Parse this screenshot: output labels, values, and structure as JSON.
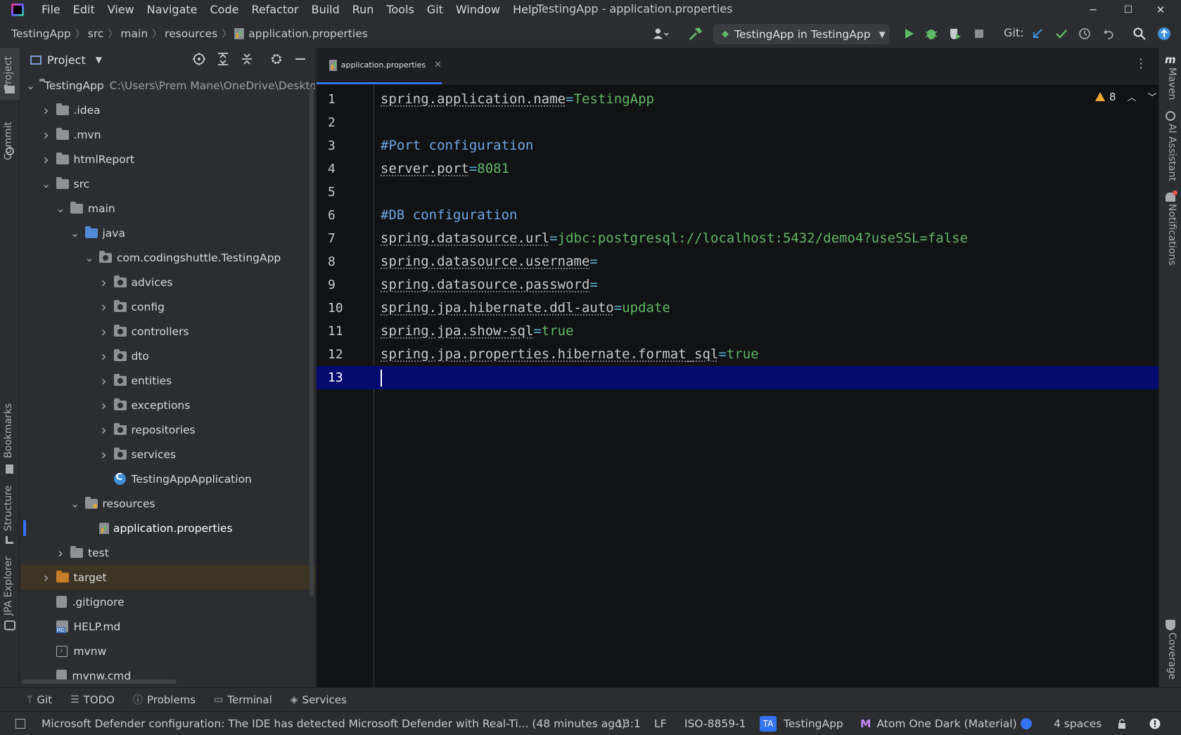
{
  "menubar": {
    "items": [
      "File",
      "Edit",
      "View",
      "Navigate",
      "Code",
      "Refactor",
      "Build",
      "Run",
      "Tools",
      "Git",
      "Window",
      "Help"
    ],
    "window_title": "TestingApp - application.properties",
    "minimize": "─",
    "maximize": "☐",
    "close": "✕"
  },
  "navbar": {
    "breadcrumbs": [
      "TestingApp",
      "src",
      "main",
      "resources",
      "application.properties"
    ],
    "run_config": "TestingApp in TestingApp",
    "git_label": "Git:"
  },
  "project_panel": {
    "title": "Project",
    "root_name": "TestingApp",
    "root_path": "C:\\Users\\Prem Mane\\OneDrive\\Deskto",
    "tree": [
      {
        "label": ".idea",
        "indent": 1,
        "chevron": "right",
        "icon": "folder"
      },
      {
        "label": ".mvn",
        "indent": 1,
        "chevron": "right",
        "icon": "folder"
      },
      {
        "label": "htmlReport",
        "indent": 1,
        "chevron": "right",
        "icon": "folder"
      },
      {
        "label": "src",
        "indent": 1,
        "chevron": "down",
        "icon": "folder"
      },
      {
        "label": "main",
        "indent": 2,
        "chevron": "down",
        "icon": "folder"
      },
      {
        "label": "java",
        "indent": 3,
        "chevron": "down",
        "icon": "folder-blue"
      },
      {
        "label": "com.codingshuttle.TestingApp",
        "indent": 4,
        "chevron": "down",
        "icon": "package"
      },
      {
        "label": "advices",
        "indent": 5,
        "chevron": "right",
        "icon": "package"
      },
      {
        "label": "config",
        "indent": 5,
        "chevron": "right",
        "icon": "package"
      },
      {
        "label": "controllers",
        "indent": 5,
        "chevron": "right",
        "icon": "package"
      },
      {
        "label": "dto",
        "indent": 5,
        "chevron": "right",
        "icon": "package"
      },
      {
        "label": "entities",
        "indent": 5,
        "chevron": "right",
        "icon": "package"
      },
      {
        "label": "exceptions",
        "indent": 5,
        "chevron": "right",
        "icon": "package"
      },
      {
        "label": "repositories",
        "indent": 5,
        "chevron": "right",
        "icon": "package"
      },
      {
        "label": "services",
        "indent": 5,
        "chevron": "right",
        "icon": "package"
      },
      {
        "label": "TestingAppApplication",
        "indent": 5,
        "chevron": "none",
        "icon": "class"
      },
      {
        "label": "resources",
        "indent": 3,
        "chevron": "down",
        "icon": "folder-res"
      },
      {
        "label": "application.properties",
        "indent": 4,
        "chevron": "none",
        "icon": "properties",
        "selected": true
      },
      {
        "label": "test",
        "indent": 2,
        "chevron": "right",
        "icon": "folder"
      },
      {
        "label": "target",
        "indent": 1,
        "chevron": "right",
        "icon": "folder-orange",
        "highlight": true
      },
      {
        "label": ".gitignore",
        "indent": 1,
        "chevron": "none",
        "icon": "file"
      },
      {
        "label": "HELP.md",
        "indent": 1,
        "chevron": "none",
        "icon": "md"
      },
      {
        "label": "mvnw",
        "indent": 1,
        "chevron": "none",
        "icon": "sh"
      },
      {
        "label": "mvnw.cmd",
        "indent": 1,
        "chevron": "none",
        "icon": "file"
      }
    ]
  },
  "left_stripe": {
    "project": "Project",
    "commit": "Commit",
    "bookmarks": "Bookmarks",
    "structure": "Structure",
    "jpa_explorer": "JPA Explorer"
  },
  "right_stripe": {
    "maven": "Maven",
    "ai_assistant": "AI Assistant",
    "notifications": "Notifications",
    "coverage": "Coverage"
  },
  "editor": {
    "tab_label": "application.properties",
    "warning_count": "8",
    "current_line": 13,
    "lines": [
      {
        "n": "1",
        "key": "spring.application.name",
        "value": "TestingApp"
      },
      {
        "n": "2"
      },
      {
        "n": "3",
        "comment": "#Port configuration"
      },
      {
        "n": "4",
        "key": "server.port",
        "value": "8081"
      },
      {
        "n": "5"
      },
      {
        "n": "6",
        "comment": "#DB configuration"
      },
      {
        "n": "7",
        "key": "spring.datasource.url",
        "value": "jdbc:postgresql://localhost:5432/demo4?useSSL=false"
      },
      {
        "n": "8",
        "key": "spring.datasource.username",
        "value": ""
      },
      {
        "n": "9",
        "key": "spring.datasource.password",
        "value": ""
      },
      {
        "n": "10",
        "key": "spring.jpa.hibernate.ddl-auto",
        "value": "update"
      },
      {
        "n": "11",
        "key": "spring.jpa.show-sql",
        "value": "true"
      },
      {
        "n": "12",
        "key": "spring.jpa.properties.hibernate.format_sql",
        "value": "true"
      },
      {
        "n": "13"
      }
    ]
  },
  "bottom_tools": {
    "git": "Git",
    "todo": "TODO",
    "problems": "Problems",
    "terminal": "Terminal",
    "services": "Services"
  },
  "statusbar": {
    "message": "Microsoft Defender configuration: The IDE has detected Microsoft Defender with Real-Ti... (48 minutes ago)",
    "position": "13:1",
    "line_sep": "LF",
    "encoding": "ISO-8859-1",
    "project_badge": "TA",
    "project": "TestingApp",
    "theme": "Atom One Dark (Material)",
    "indent": "4 spaces"
  },
  "colors": {
    "accent": "#3574f0",
    "current_line_bg": "#040a6e",
    "string_value": "#5fb865",
    "comment": "#6ea7e8",
    "warning": "#f0a732"
  }
}
